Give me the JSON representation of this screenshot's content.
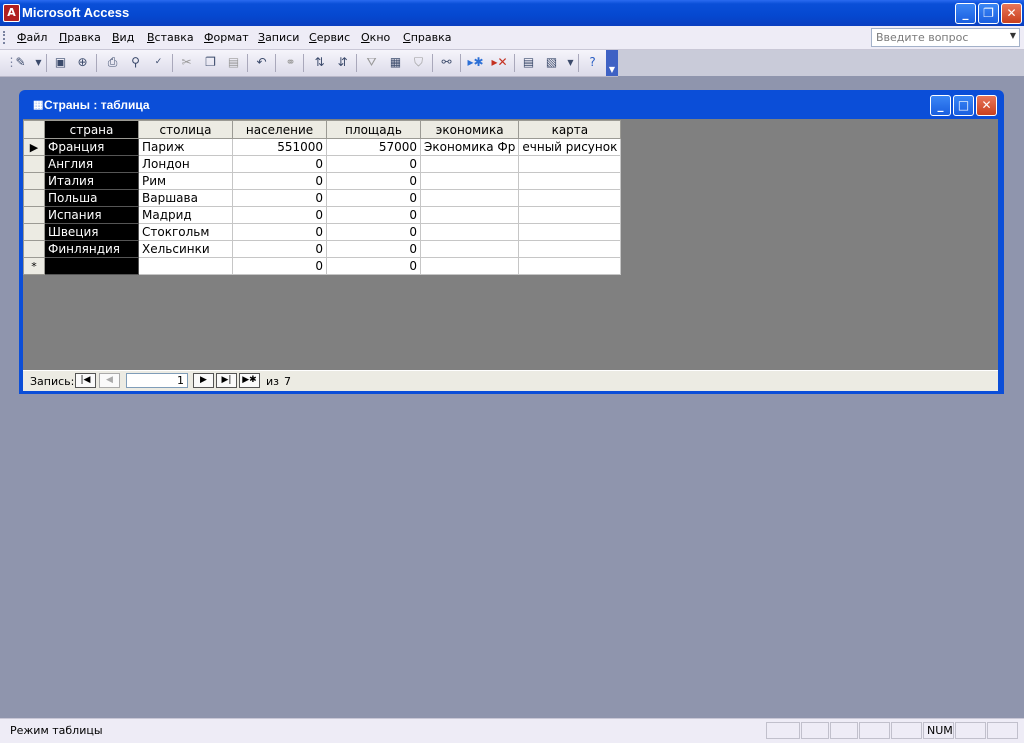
{
  "app": {
    "title": "Microsoft Access"
  },
  "menu": [
    "Файл",
    "Правка",
    "Вид",
    "Вставка",
    "Формат",
    "Записи",
    "Сервис",
    "Окно",
    "Справка"
  ],
  "ask_box": {
    "placeholder": "Введите вопрос"
  },
  "document": {
    "title": "Страны : таблица",
    "columns": [
      "страна",
      "столица",
      "население",
      "площадь",
      "экономика",
      "карта"
    ],
    "rows": [
      [
        "Франция",
        "Париж",
        "551000",
        "57000",
        "Экономика Фр",
        "ечный рисунок"
      ],
      [
        "Англия",
        "Лондон",
        "0",
        "0",
        "",
        ""
      ],
      [
        "Италия",
        "Рим",
        "0",
        "0",
        "",
        ""
      ],
      [
        "Польша",
        "Варшава",
        "0",
        "0",
        "",
        ""
      ],
      [
        "Испания",
        "Мадрид",
        "0",
        "0",
        "",
        ""
      ],
      [
        "Швеция",
        "Стокгольм",
        "0",
        "0",
        "",
        ""
      ],
      [
        "Финляндия",
        "Хельсинки",
        "0",
        "0",
        "",
        ""
      ]
    ],
    "new_row": [
      "",
      "",
      "0",
      "0",
      "",
      ""
    ],
    "new_row_marker": "*",
    "current_row_marker": "▶"
  },
  "navigation": {
    "label": "Запись:",
    "current": "1",
    "of_label": "из",
    "total": "7"
  },
  "status": {
    "text": "Режим таблицы",
    "num": "NUM"
  },
  "colors": {
    "title_bar": "#0a4fd8",
    "workspace": "#8f95ad",
    "datasheet_bg": "#808080"
  }
}
